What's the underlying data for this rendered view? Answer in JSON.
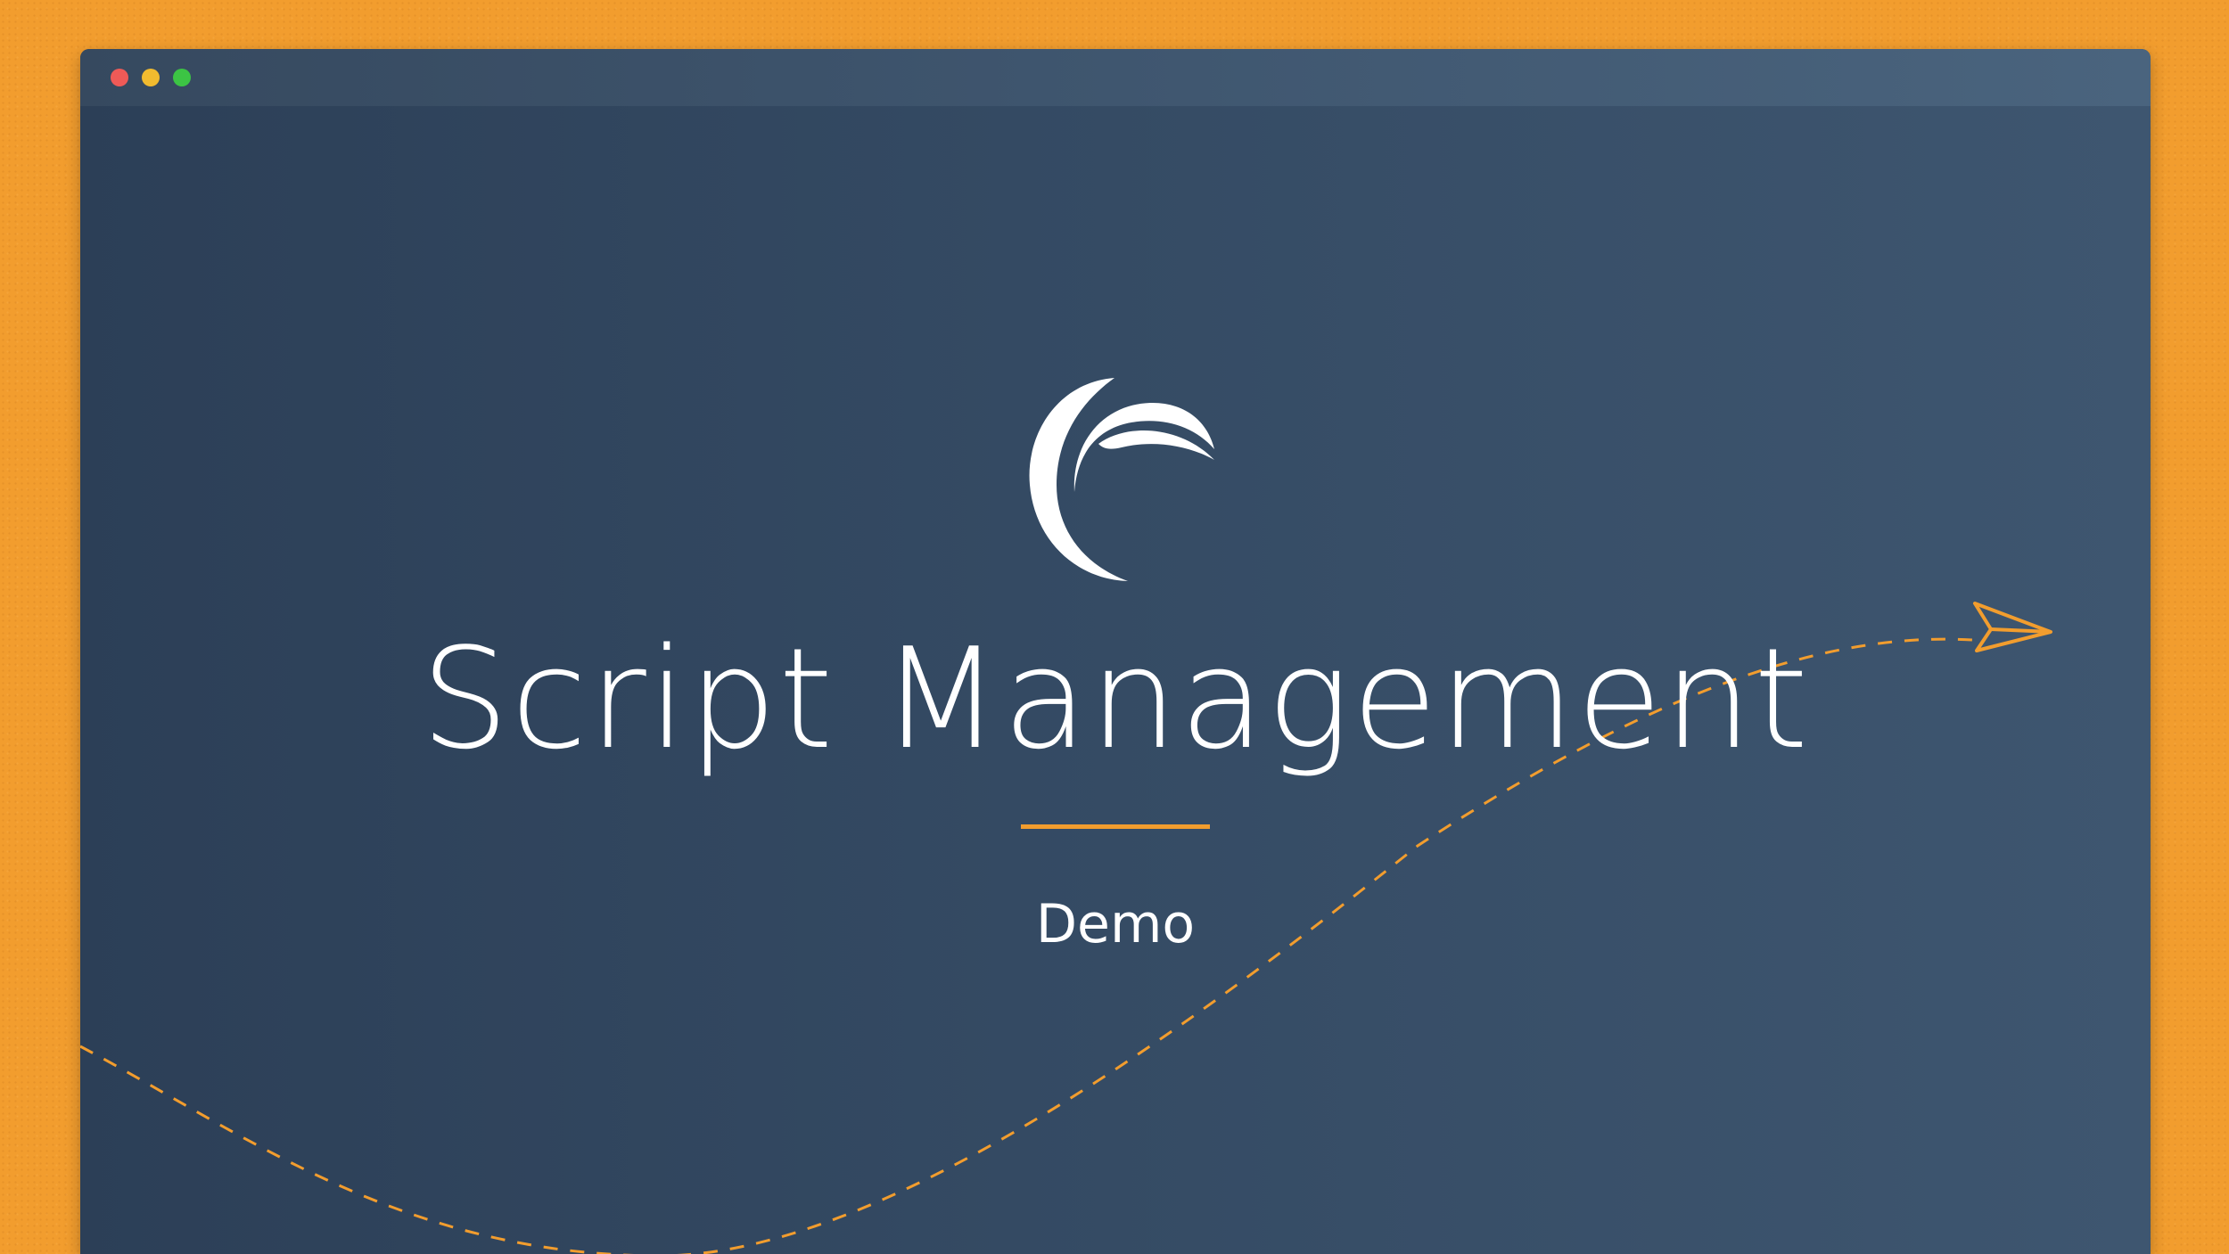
{
  "page": {
    "title": "Script Management",
    "subtitle": "Demo"
  },
  "window_controls": {
    "close_color": "#ef5a57",
    "minimize_color": "#f1bb2f",
    "maximize_color": "#3cc444"
  },
  "colors": {
    "background": "#f29d2e",
    "window": "#344a63",
    "accent": "#f29d2e",
    "text": "#ffffff"
  },
  "icons": {
    "logo": "crescent-logo-icon",
    "paper_plane": "paper-plane-icon"
  }
}
